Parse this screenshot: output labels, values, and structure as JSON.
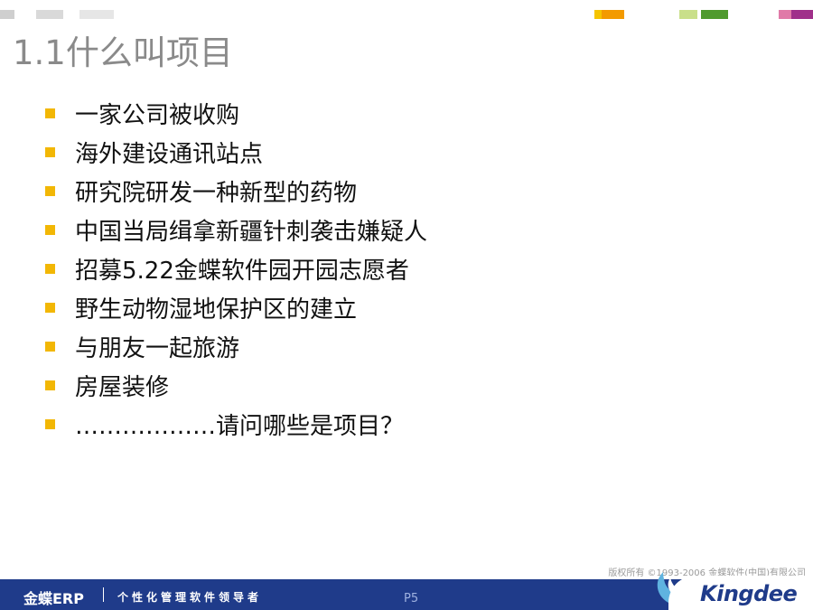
{
  "colors": {
    "title": "#8a8a8a",
    "bullet": "#f2b705",
    "footer_bar": "#1f3b8a"
  },
  "slide": {
    "title": "1.1什么叫项目",
    "bullets": [
      "一家公司被收购",
      "海外建设通讯站点",
      "研究院研发一种新型的药物",
      "中国当局缉拿新疆针刺袭击嫌疑人",
      "招募5.22金蝶软件园开园志愿者",
      "野生动物湿地保护区的建立",
      "与朋友一起旅游",
      "房屋装修",
      "………………请问哪些是项目？"
    ]
  },
  "footer": {
    "copyright": "版权所有 ©1993-2006 金蝶软件(中国)有限公司",
    "brand": "金蝶ERP",
    "tagline": "个性化管理软件领导者",
    "page": "P5",
    "logo": "Kingdee"
  }
}
